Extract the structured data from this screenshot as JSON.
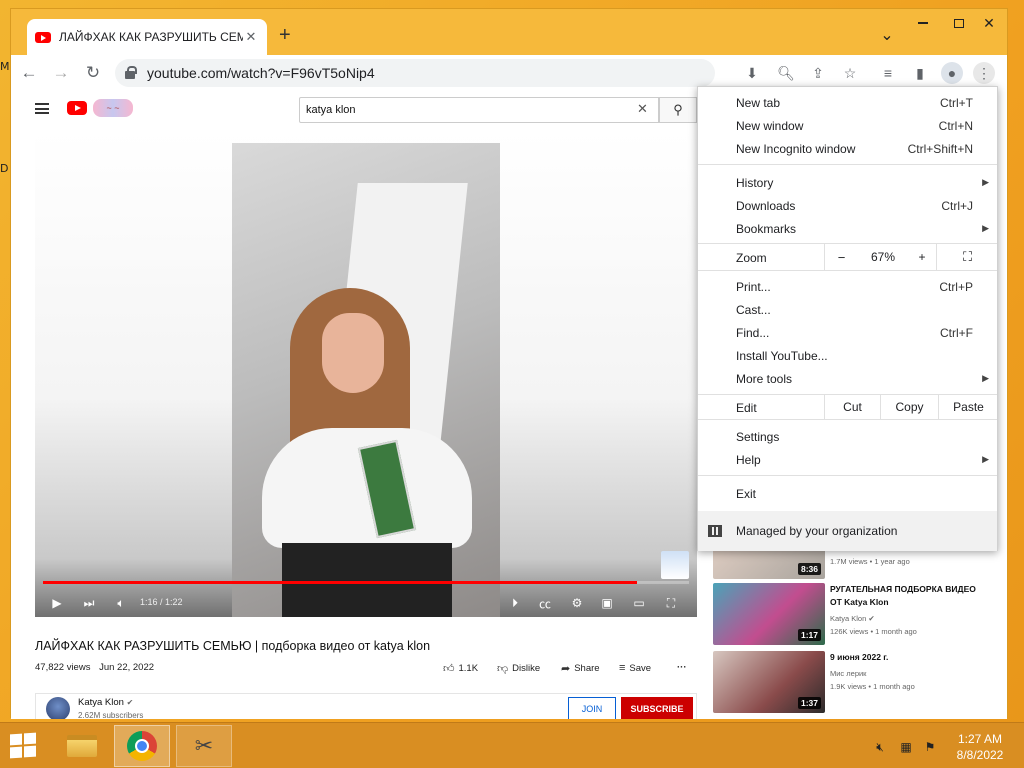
{
  "desktop": {
    "left_edge_chars": [
      "M",
      "D"
    ]
  },
  "browser": {
    "tab_title": "ЛАЙФХАК КАК РАЗРУШИТЬ СЕМ",
    "tab_close": "✕",
    "new_tab": "+",
    "tab_search": "⌄",
    "url": "youtube.com/watch?v=F96vT5oNip4"
  },
  "youtube": {
    "search_value": "katya klon",
    "doodle_text": "~ ~",
    "video": {
      "time": "1:16 / 1:22",
      "progress": 0.92
    },
    "title": "ЛАЙФХАК КАК РАЗРУШИТЬ СЕМЬЮ | подборка видео от katya klon",
    "views": "47,822 views",
    "date": "Jun 22, 2022",
    "actions": {
      "likes": "1.1K",
      "dislike": "Dislike",
      "share": "Share",
      "save": "Save",
      "more": "···"
    },
    "channel": {
      "name": "Katya Klon",
      "verified": "✔",
      "subs": "2.62M subscribers",
      "join": "JOIN",
      "subscribe": "SUBSCRIBE"
    },
    "recommended": [
      {
        "duration": "8:36",
        "views": "1.7M views",
        "ago": "1 year ago"
      },
      {
        "title": "РУГАТЕЛЬНАЯ ПОДБОРКА ВИДЕО ОТ Katya Klon",
        "channel": "Katya Klon",
        "verified": "✔",
        "views": "126K views",
        "ago": "1 month ago",
        "duration": "1:17"
      },
      {
        "title": "9 июня 2022 г.",
        "channel": "Мис лерик",
        "views": "1.9K views",
        "ago": "1 month ago",
        "duration": "1:37"
      }
    ]
  },
  "menu": {
    "items": [
      {
        "label": "New tab",
        "shortcut": "Ctrl+T"
      },
      {
        "label": "New window",
        "shortcut": "Ctrl+N"
      },
      {
        "label": "New Incognito window",
        "shortcut": "Ctrl+Shift+N"
      },
      {
        "label": "History",
        "arrow": "▶"
      },
      {
        "label": "Downloads",
        "shortcut": "Ctrl+J"
      },
      {
        "label": "Bookmarks",
        "arrow": "▶"
      },
      {
        "label": "Print...",
        "shortcut": "Ctrl+P"
      },
      {
        "label": "Cast..."
      },
      {
        "label": "Find...",
        "shortcut": "Ctrl+F"
      },
      {
        "label": "Install YouTube..."
      },
      {
        "label": "More tools",
        "arrow": "▶"
      },
      {
        "label": "Settings"
      },
      {
        "label": "Help",
        "arrow": "▶"
      },
      {
        "label": "Exit"
      }
    ],
    "zoom": {
      "label": "Zoom",
      "minus": "−",
      "value": "67%",
      "plus": "+"
    },
    "edit": {
      "label": "Edit",
      "cut": "Cut",
      "copy": "Copy",
      "paste": "Paste"
    },
    "managed": "Managed by your organization"
  },
  "taskbar": {
    "time": "1:27 AM",
    "date": "8/8/2022"
  },
  "colors": {
    "accent_red": "#ff0000",
    "subscribe_red": "#cc0000",
    "join_blue": "#065fd4",
    "desktop_orange": "#f0a020"
  }
}
